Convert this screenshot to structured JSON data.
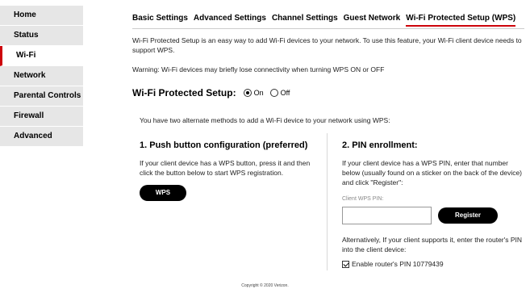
{
  "sidebar": {
    "items": [
      {
        "label": "Home"
      },
      {
        "label": "Status"
      },
      {
        "label": "Wi-Fi"
      },
      {
        "label": "Network"
      },
      {
        "label": "Parental Controls"
      },
      {
        "label": "Firewall"
      },
      {
        "label": "Advanced"
      }
    ],
    "active": "Wi-Fi"
  },
  "tabs": [
    {
      "label": "Basic Settings"
    },
    {
      "label": "Advanced Settings"
    },
    {
      "label": "Channel Settings"
    },
    {
      "label": "Guest Network"
    },
    {
      "label": "Wi-Fi Protected Setup (WPS)"
    }
  ],
  "active_tab": "Wi-Fi Protected Setup (WPS)",
  "intro": "Wi-Fi Protected Setup is an easy way to add Wi-Fi devices to your network. To use this feature, your Wi-Fi client device needs to support WPS.",
  "warning": "Warning: Wi-Fi devices may briefly lose connectivity when turning WPS ON or OFF",
  "wps_setup": {
    "title": "Wi-Fi Protected Setup:",
    "on_label": "On",
    "off_label": "Off",
    "selected": "On"
  },
  "methods_text": "You have two alternate methods to add a Wi-Fi device to your network using WPS:",
  "push": {
    "title": "1. Push button configuration (preferred)",
    "description": "If your client device has a WPS button, press it and then click the button below to start WPS registration.",
    "button_label": "WPS"
  },
  "pin": {
    "title": "2. PIN enrollment:",
    "description": "If your client device has a WPS PIN, enter that number below (usually found on a sticker on the back of the device) and click \"Register\":",
    "input_label": "Client WPS PIN:",
    "input_value": "",
    "button_label": "Register",
    "alt_description": "Alternatively, If your client supports it, enter the router's PIN into the client device:",
    "enable_label": "Enable router's PIN 10779439",
    "enable_checked": true
  },
  "copyright": "Copyright © 2020 Verizon.",
  "colors": {
    "accent": "#cd040b",
    "sidebar_bg": "#e6e6e6",
    "button_bg": "#000000"
  }
}
